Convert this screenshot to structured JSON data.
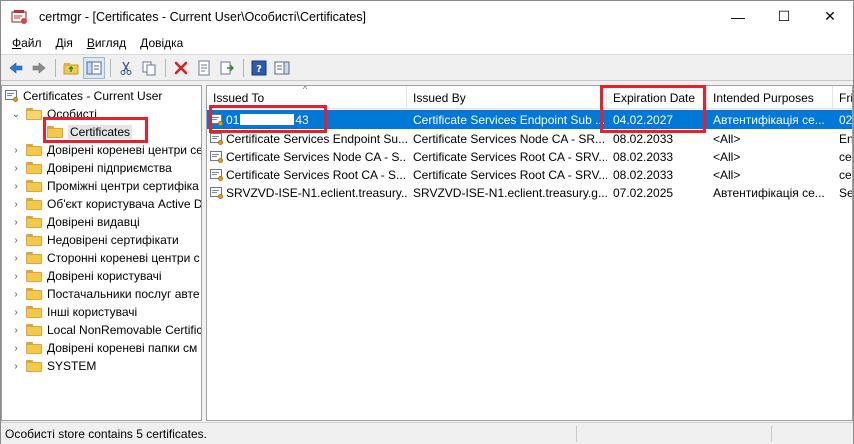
{
  "window": {
    "title": "certmgr - [Certificates - Current User\\Особисті\\Certificates]",
    "controls": {
      "minimize": "—",
      "maximize": "☐",
      "close": "✕"
    }
  },
  "menu": [
    {
      "label": "Файл",
      "accel": "Ф",
      "rest": "айл"
    },
    {
      "label": "Дія",
      "accel": "Д",
      "rest": "ія"
    },
    {
      "label": "Вигляд",
      "accel": "В",
      "rest": "игляд"
    },
    {
      "label": "Довідка",
      "accel": "Д",
      "rest": "овідка"
    }
  ],
  "toolbar": {
    "icons": [
      "back-arrow-icon",
      "forward-arrow-icon",
      "up-folder-icon",
      "show-hide-tree-icon",
      "cut-icon",
      "copy-icon",
      "delete-icon",
      "properties-icon",
      "export-icon",
      "help-icon",
      "show-hide-action-pane-icon"
    ]
  },
  "tree": {
    "root": "Certificates - Current User",
    "personal": "Особисті",
    "selected": "Certificates",
    "items": [
      "Довірені кореневі центри се",
      "Довірені підприємства",
      "Проміжні центри сертифіка",
      "Об'єкт користувача Active D",
      "Довірені видавці",
      "Недовірені сертифікати",
      "Сторонні кореневі центри с",
      "Довірені користувачі",
      "Постачальники послуг авте",
      "Інші користувачі",
      "Local NonRemovable Certific",
      "Довірені кореневі папки см",
      "SYSTEM"
    ]
  },
  "list": {
    "columns": [
      "Issued To",
      "Issued By",
      "Expiration Date",
      "Intended Purposes",
      "Fri"
    ],
    "sort_arrow": "^",
    "rows": [
      {
        "issued_to_start": "01",
        "issued_to_end": "43",
        "issued_by": "Certificate Services Endpoint Sub ...",
        "expiration": "04.02.2027",
        "purposes": "Автентифікація се...",
        "friendly": "02("
      },
      {
        "issued_to": "Certificate Services Endpoint Su...",
        "issued_by": "Certificate Services Node CA - SR...",
        "expiration": "08.02.2033",
        "purposes": "<All>",
        "friendly": "En"
      },
      {
        "issued_to": "Certificate Services Node CA - S...",
        "issued_by": "Certificate Services Root CA - SRV...",
        "expiration": "08.02.2033",
        "purposes": "<All>",
        "friendly": "cer"
      },
      {
        "issued_to": "Certificate Services Root CA - S...",
        "issued_by": "Certificate Services Root CA - SRV...",
        "expiration": "08.02.2033",
        "purposes": "<All>",
        "friendly": "cer"
      },
      {
        "issued_to": "SRVZVD-ISE-N1.eclient.treasury....",
        "issued_by": "SRVZVD-ISE-N1.eclient.treasury.g...",
        "expiration": "07.02.2025",
        "purposes": "Автентифікація се...",
        "friendly": "Sel"
      }
    ]
  },
  "status": {
    "text": "Особисті store contains 5 certificates."
  },
  "colors": {
    "selection": "#0078d7",
    "highlight_box": "#e8202a"
  }
}
